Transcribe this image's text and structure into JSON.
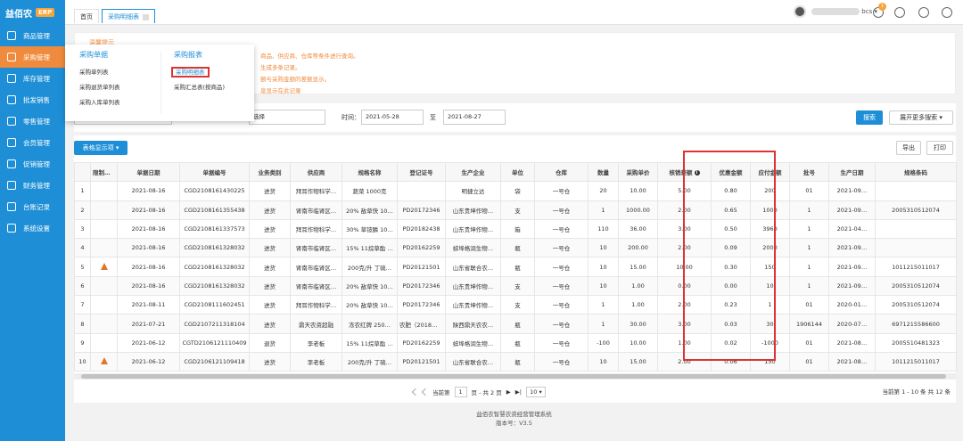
{
  "app": {
    "name": "益佰农",
    "tag": "ERP"
  },
  "sidebar": {
    "items": [
      {
        "label": "商品管理"
      },
      {
        "label": "采购管理"
      },
      {
        "label": "库存管理"
      },
      {
        "label": "批发销售"
      },
      {
        "label": "零售管理"
      },
      {
        "label": "会员管理"
      },
      {
        "label": "促销管理"
      },
      {
        "label": "财务管理"
      },
      {
        "label": "台账记录"
      },
      {
        "label": "系统设置"
      }
    ]
  },
  "tabs": {
    "home": "首页",
    "active": "采购明细表"
  },
  "user": {
    "name_suffix": "bcs",
    "notif_count": "1"
  },
  "tips": {
    "title": "温馨提示",
    "lines": [
      "商品、供应商、仓库等条件进行查询。",
      "生成多条记录。",
      "额与采购金额的差额显示。",
      "息显示在此记录"
    ]
  },
  "dropdown": {
    "col1_title": "采购单据",
    "col1_items": [
      "采购单列表",
      "采购退货单列表",
      "采购入库单列表"
    ],
    "col2_title": "采购报表",
    "col2_items": [
      "采购明细表",
      "采购汇总表(按商品)"
    ]
  },
  "search": {
    "field1": "",
    "field2": "选择",
    "time_label": "时间：",
    "date_from": "2021-05-28",
    "to_label": "至",
    "date_to": "2021-08-27",
    "search_btn": "搜索",
    "more_btn": "展开更多搜索"
  },
  "table_actions": {
    "display_btn": "表格显示项",
    "export": "导出",
    "print": "打印"
  },
  "table": {
    "headers": [
      "",
      "限制使用",
      "单据日期",
      "单据编号",
      "业务类别",
      "供应商",
      "规格名称",
      "登记证号",
      "生产企业",
      "单位",
      "仓库",
      "数量",
      "采购单价",
      "核销差额",
      "优惠金额",
      "应付金额",
      "批号",
      "生产日期",
      "规格条码"
    ],
    "rows": [
      [
        "1",
        "",
        "2021-08-16",
        "CGD2108161430225",
        "进货",
        "拜耳作物科学…",
        "蔬菜 1000克",
        "",
        "明捷立达",
        "袋",
        "一号仓",
        "20",
        "10.00",
        "5.00",
        "0.80",
        "200",
        "01",
        "2021-09…",
        ""
      ],
      [
        "2",
        "",
        "2021-08-16",
        "CGD2108161355438",
        "进货",
        "肾南市临肾区…",
        "20% 敌草快 10…",
        "PD20172346",
        "山东贵坤作物…",
        "支",
        "一号仓",
        "1",
        "1000.00",
        "2.00",
        "0.65",
        "1000",
        "1",
        "2021-09…",
        "2005310512074"
      ],
      [
        "3",
        "",
        "2021-08-16",
        "CGD2108161337573",
        "进货",
        "拜耳作物科学…",
        "30% 草铵膦 10…",
        "PD20182438",
        "山东贵坤作物…",
        "箱",
        "一号仓",
        "110",
        "36.00",
        "3.00",
        "0.50",
        "3960",
        "1",
        "2021-04…",
        ""
      ],
      [
        "4",
        "",
        "2021-08-16",
        "CGD2108161328032",
        "进货",
        "肾南市临肾区…",
        "15% 11烷草酯 …",
        "PD20162259",
        "蚌埠格润生物…",
        "瓶",
        "一号仓",
        "10",
        "200.00",
        "2.00",
        "0.09",
        "2000",
        "1",
        "2021-09…",
        ""
      ],
      [
        "5",
        "warn",
        "2021-08-16",
        "CGD2108161328032",
        "进货",
        "肾南市临肾区…",
        "200克/升 丁硫…",
        "PD20121501",
        "山东省联合农…",
        "瓶",
        "一号仓",
        "10",
        "15.00",
        "10.00",
        "0.30",
        "150",
        "1",
        "2021-09…",
        "1011215011017"
      ],
      [
        "6",
        "",
        "2021-08-16",
        "CGD2108161328032",
        "进货",
        "肾南市临肾区…",
        "20% 敌草快 10…",
        "PD20172346",
        "山东贵坤作物…",
        "支",
        "一号仓",
        "10",
        "1.00",
        "0.00",
        "0.00",
        "10",
        "1",
        "2021-09…",
        "2005310512074"
      ],
      [
        "7",
        "",
        "2021-08-11",
        "CGD2108111602451",
        "进货",
        "拜耳作物科学…",
        "20% 敌草快 10…",
        "PD20172346",
        "山东贵坤作物…",
        "支",
        "一号仓",
        "1",
        "1.00",
        "2.00",
        "0.23",
        "1",
        "01",
        "2020-01…",
        "2005310512074"
      ],
      [
        "8",
        "",
        "2021-07-21",
        "CGD2107211318104",
        "进货",
        "鼎天农资超融",
        "冻农红牌 250…",
        "农肥（2018）…",
        "陕西鼎天农农…",
        "瓶",
        "一号仓",
        "1",
        "30.00",
        "3.00",
        "0.03",
        "30",
        "1906144",
        "2020-07…",
        "6971215586600"
      ],
      [
        "9",
        "",
        "2021-06-12",
        "CGTD2106121110409",
        "退货",
        "李老板",
        "15% 11烷草酯 …",
        "PD20162259",
        "蚌埠格润生物…",
        "瓶",
        "一号仓",
        "-100",
        "10.00",
        "1.00",
        "0.02",
        "-1000",
        "01",
        "2021-08…",
        "2005510481323"
      ],
      [
        "10",
        "warn",
        "2021-06-12",
        "CGD2106121109418",
        "进货",
        "李老板",
        "200克/升 丁硫…",
        "PD20121501",
        "山东省联合农…",
        "瓶",
        "一号仓",
        "10",
        "15.00",
        "2.00",
        "0.06",
        "150",
        "01",
        "2021-08…",
        "1011215011017"
      ]
    ]
  },
  "pager": {
    "prefix": "当前第",
    "page": "1",
    "middle": "页 - 共 2 页",
    "size": "10",
    "right": "当前第 1 - 10 条  共 12 条"
  },
  "footer": {
    "line1": "益佰农智慧农资经营管理系统",
    "line2": "版本号：V3.5"
  },
  "colors": {
    "brand": "#1e8fd6",
    "active_nav": "#f08a3c",
    "highlight": "#d33333"
  }
}
